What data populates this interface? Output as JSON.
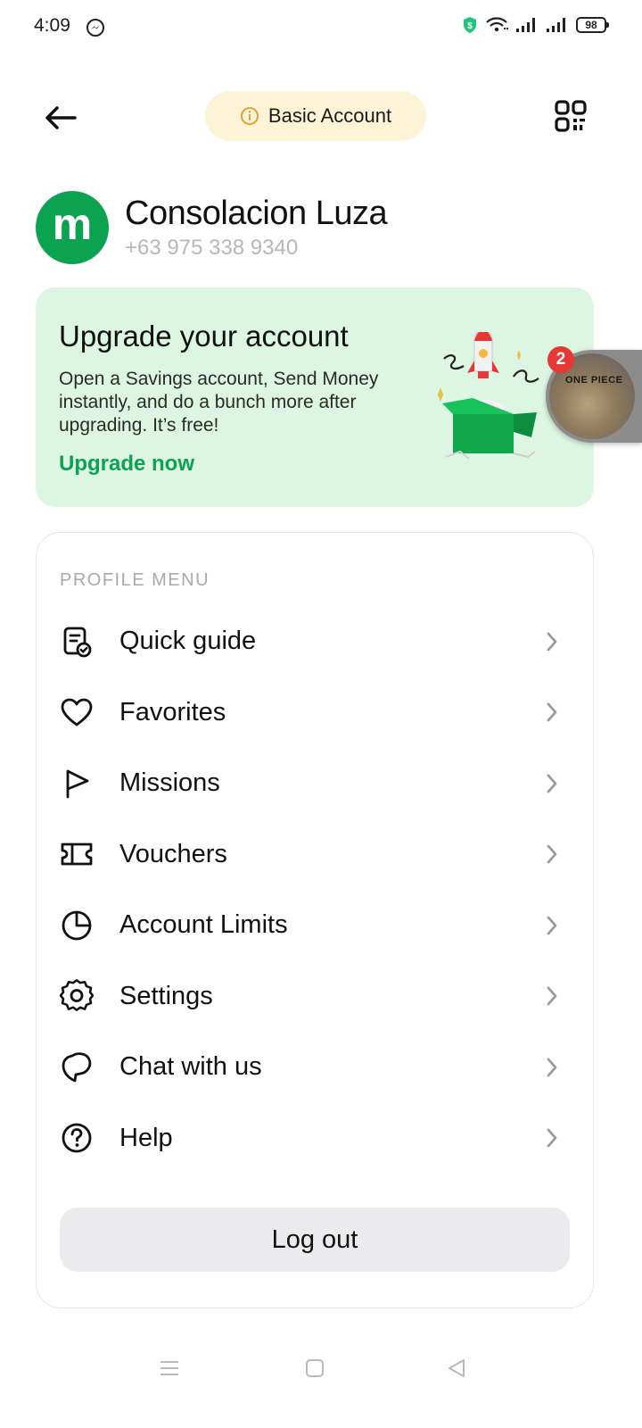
{
  "status_bar": {
    "time": "4:09",
    "battery": "98",
    "icons": [
      "messenger-icon",
      "shield-icon",
      "wifi-icon",
      "signal-icon",
      "signal-icon",
      "battery-icon"
    ]
  },
  "header": {
    "back_icon": "arrow-left-icon",
    "account_badge": "Basic Account",
    "account_badge_icon": "info-icon",
    "qr_icon": "qr-code-icon"
  },
  "profile": {
    "avatar_letter": "m",
    "name": "Consolacion Luza",
    "phone": "+63 975 338 9340"
  },
  "upgrade": {
    "title": "Upgrade your account",
    "description": "Open a Savings account, Send Money instantly, and do a bunch more after upgrading. It’s free!",
    "cta": "Upgrade now"
  },
  "chat_head": {
    "badge_count": "2",
    "label": "ONE PIECE"
  },
  "menu": {
    "heading": "PROFILE MENU",
    "items": [
      {
        "label": "Quick guide",
        "icon": "guide-icon"
      },
      {
        "label": "Favorites",
        "icon": "heart-icon"
      },
      {
        "label": "Missions",
        "icon": "flag-icon"
      },
      {
        "label": "Vouchers",
        "icon": "ticket-icon"
      },
      {
        "label": "Account Limits",
        "icon": "pie-chart-icon"
      },
      {
        "label": "Settings",
        "icon": "gear-icon"
      },
      {
        "label": "Chat with us",
        "icon": "chat-icon"
      },
      {
        "label": "Help",
        "icon": "help-icon"
      }
    ],
    "logout": "Log out"
  },
  "colors": {
    "brand_green": "#0ca350",
    "upgrade_bg": "#ddf5e3",
    "badge_bg": "#fdf4d7",
    "badge_icon": "#e0a23a",
    "notification_red": "#e53935"
  }
}
